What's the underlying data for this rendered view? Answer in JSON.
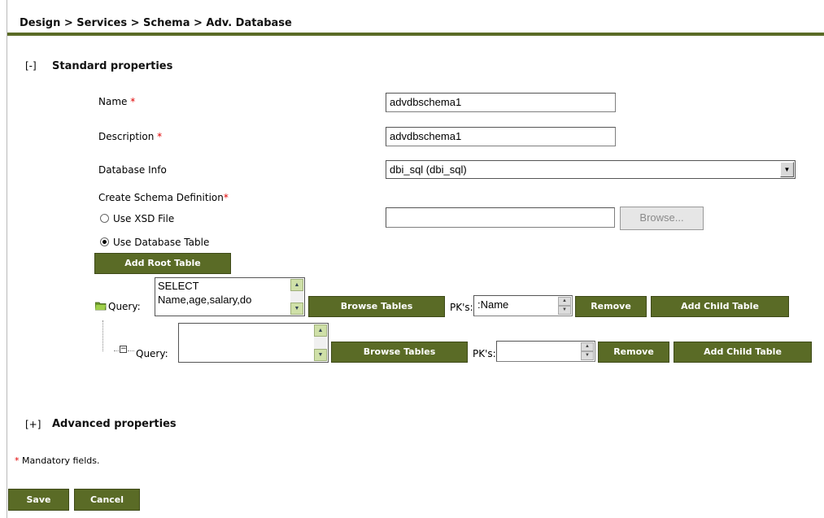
{
  "breadcrumb": "Design > Services > Schema > Adv. Database",
  "standard": {
    "toggle": "[-]",
    "title": "Standard properties"
  },
  "fields": {
    "name_label": "Name",
    "name_value": "advdbschema1",
    "description_label": "Description",
    "description_value": "advdbschema1",
    "database_info_label": "Database Info",
    "database_info_value": "dbi_sql (dbi_sql)",
    "create_schema_label": "Create Schema Definition",
    "required_mark": "*"
  },
  "schema": {
    "use_xsd_label": "Use XSD File",
    "xsd_value": "",
    "browse_label": "Browse...",
    "use_table_label": "Use Database Table",
    "selected": "Use Database Table",
    "add_root_label": "Add Root Table"
  },
  "query_rows": [
    {
      "query_label": "Query:",
      "query_text": "SELECT\nName,age,salary,do",
      "browse_tables_label": "Browse Tables",
      "pk_label": "PK's:",
      "pk_value": ":Name",
      "remove_label": "Remove",
      "add_child_label": "Add Child Table"
    },
    {
      "query_label": "Query:",
      "query_text": "",
      "browse_tables_label": "Browse Tables",
      "pk_label": "PK's:",
      "pk_value": "",
      "remove_label": "Remove",
      "add_child_label": "Add Child Table"
    }
  ],
  "advanced": {
    "toggle": "[+]",
    "title": "Advanced properties"
  },
  "footer": {
    "mandatory_mark": "*",
    "mandatory_note": "Mandatory fields.",
    "save_label": "Save",
    "cancel_label": "Cancel"
  },
  "colors": {
    "accent": "#5a6b26",
    "required": "#e00000"
  }
}
